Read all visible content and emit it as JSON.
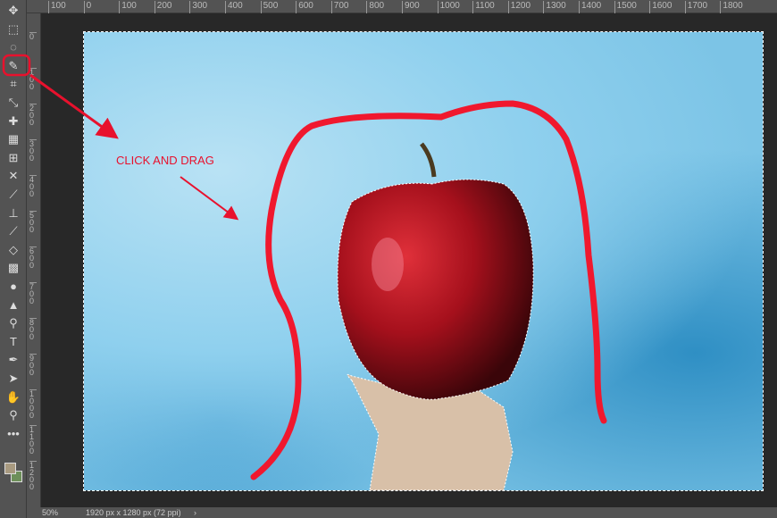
{
  "toolbar": {
    "tools": [
      "move-icon",
      "marquee-icon",
      "lasso-icon",
      "quick-selection-icon",
      "crop-icon",
      "eyedropper-icon",
      "healing-brush-icon",
      "patch-icon",
      "content-aware-icon",
      "puppet-warp-icon",
      "brush-icon",
      "clone-stamp-icon",
      "history-brush-icon",
      "eraser-icon",
      "gradient-icon",
      "blur-icon",
      "sharpen-icon",
      "dodge-icon",
      "type-icon",
      "pen-icon",
      "path-select-icon",
      "hand-icon",
      "zoom-icon",
      "more-icon"
    ],
    "type_label": "T",
    "foreground_color": "#a89a80",
    "background_color": "#6d8f5a"
  },
  "ruler": {
    "h_labels": [
      "100",
      "0",
      "100",
      "200",
      "300",
      "400",
      "500",
      "600",
      "700",
      "800",
      "900",
      "1000",
      "1100",
      "1200",
      "1300",
      "1400",
      "1500",
      "1600",
      "1700",
      "1800"
    ],
    "v_labels": [
      "0",
      "100",
      "200",
      "300",
      "400",
      "500",
      "600",
      "700",
      "800",
      "900",
      "1000",
      "1100",
      "1200"
    ]
  },
  "annotation": {
    "text": "CLICK AND DRAG",
    "color": "#e8112d"
  },
  "status": {
    "zoom": "50%",
    "doc_info": "1920 px x 1280 px (72 ppi)",
    "arrow": "›"
  }
}
